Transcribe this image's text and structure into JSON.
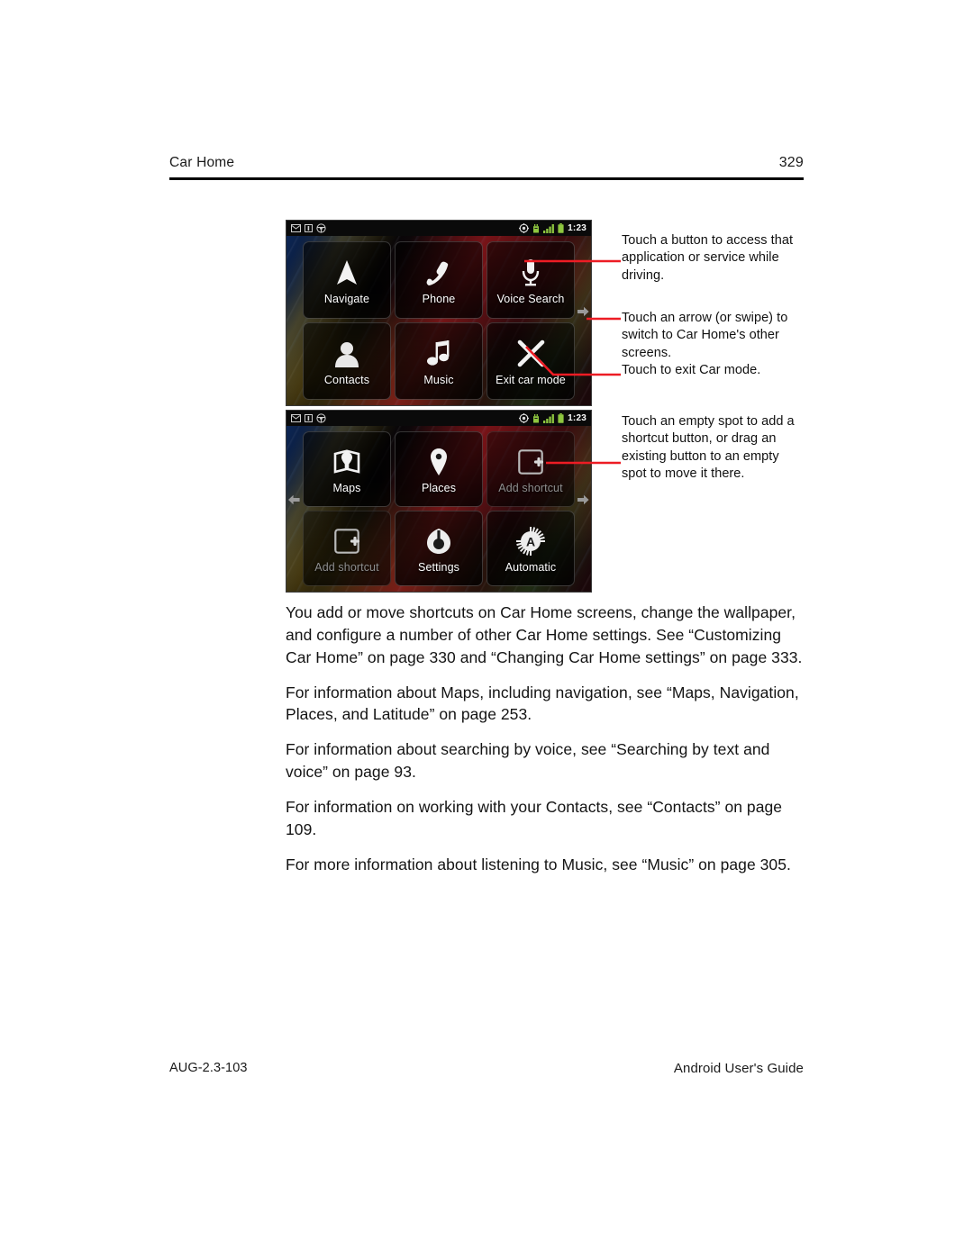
{
  "header": {
    "chapter_title": "Car Home",
    "page_number": "329"
  },
  "figure": {
    "screens": [
      {
        "name": "car-home-screen-1",
        "statusbar": {
          "left_icons": [
            "mail-icon",
            "sim-card-icon",
            "steering-wheel-icon"
          ],
          "right_icons": [
            "gps-icon",
            "usb-debug-icon",
            "signal-bars-icon",
            "battery-icon"
          ],
          "time": "1:23"
        },
        "page_arrows": {
          "left": false,
          "right": true
        },
        "tiles": [
          {
            "label": "Navigate",
            "icon": "navigate-arrow-icon",
            "empty": false
          },
          {
            "label": "Phone",
            "icon": "phone-handset-icon",
            "empty": false
          },
          {
            "label": "Voice Search",
            "icon": "microphone-icon",
            "empty": false
          },
          {
            "label": "Contacts",
            "icon": "person-icon",
            "empty": false
          },
          {
            "label": "Music",
            "icon": "music-note-icon",
            "empty": false
          },
          {
            "label": "Exit car mode",
            "icon": "close-x-icon",
            "empty": false
          }
        ]
      },
      {
        "name": "car-home-screen-2",
        "statusbar": {
          "left_icons": [
            "mail-icon",
            "sim-card-icon",
            "steering-wheel-icon"
          ],
          "right_icons": [
            "gps-icon",
            "usb-debug-icon",
            "signal-bars-icon",
            "battery-icon"
          ],
          "time": "1:23"
        },
        "page_arrows": {
          "left": true,
          "right": true
        },
        "tiles": [
          {
            "label": "Maps",
            "icon": "map-pin-book-icon",
            "empty": false
          },
          {
            "label": "Places",
            "icon": "place-pin-icon",
            "empty": false
          },
          {
            "label": "Add shortcut",
            "icon": "add-shortcut-icon",
            "empty": true
          },
          {
            "label": "Add shortcut",
            "icon": "add-shortcut-icon",
            "empty": true
          },
          {
            "label": "Settings",
            "icon": "settings-gear-icon",
            "empty": false
          },
          {
            "label": "Automatic",
            "icon": "automatic-badge-icon",
            "empty": false
          }
        ]
      }
    ],
    "callouts": [
      {
        "id": "callout-1",
        "text": "Touch a button to access that application or service while driving."
      },
      {
        "id": "callout-2",
        "text": "Touch an arrow (or swipe) to switch to Car Home's other screens."
      },
      {
        "id": "callout-3",
        "text": "Touch to exit Car mode."
      },
      {
        "id": "callout-4",
        "text": "Touch an empty spot to add a shortcut button, or drag an existing button to an empty spot to move it there."
      }
    ],
    "leader_color": "#ED1C24"
  },
  "body": {
    "paragraphs": [
      "You add or move shortcuts on Car Home screens, change the wallpaper, and configure a number of other Car Home settings. See “Customizing Car Home” on page 330 and “Changing Car Home settings” on page 333.",
      "For information about Maps, including navigation, see “Maps, Navigation, Places, and Latitude” on page 253.",
      "For information about searching by voice, see “Searching by text and voice” on page 93.",
      "For information on working with your Contacts, see “Contacts” on page 109.",
      "For more information about listening to Music, see “Music” on page 305."
    ]
  },
  "footer": {
    "doc_code": "AUG-2.3-103",
    "guide_title": "Android User's Guide"
  }
}
